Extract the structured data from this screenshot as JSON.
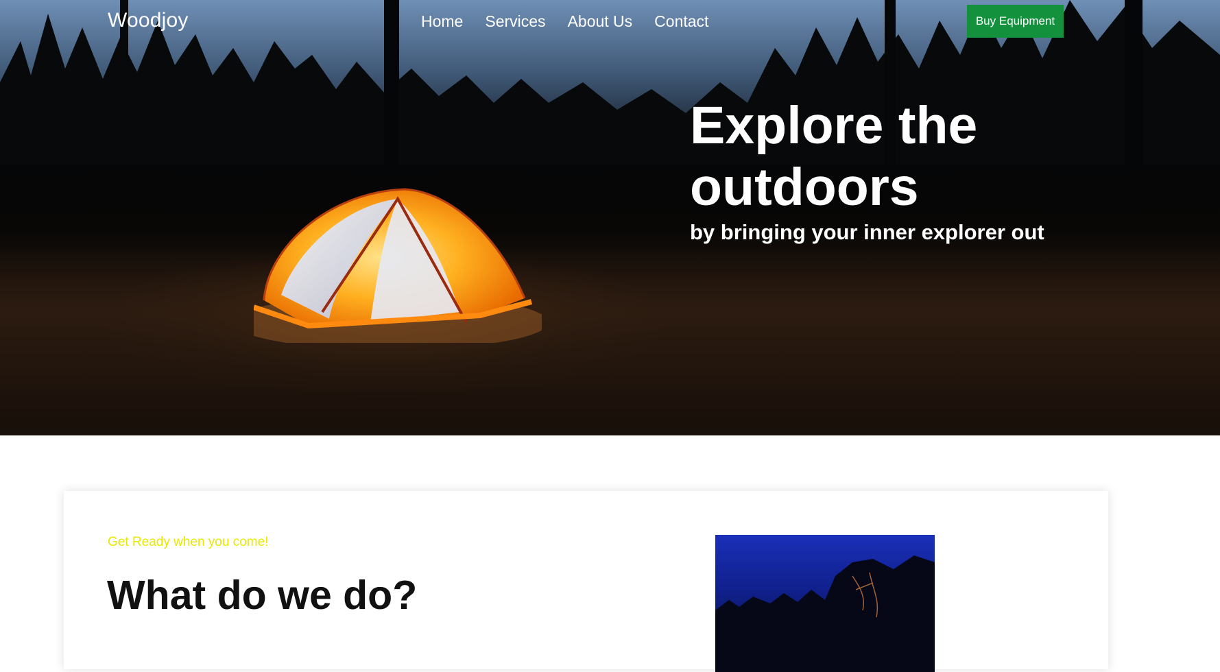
{
  "nav": {
    "logo": "Woodjoy",
    "links": [
      "Home",
      "Services",
      "About Us",
      "Contact"
    ],
    "cta": "Buy Equipment"
  },
  "hero": {
    "title": "Explore the outdoors",
    "subtitle": "by bringing your inner explorer out"
  },
  "section": {
    "eyebrow": "Get Ready when you come!",
    "title": "What do we do?"
  },
  "colors": {
    "cta_background": "#14913d",
    "eyebrow": "#e8e800",
    "hero_text": "#ffffff"
  }
}
